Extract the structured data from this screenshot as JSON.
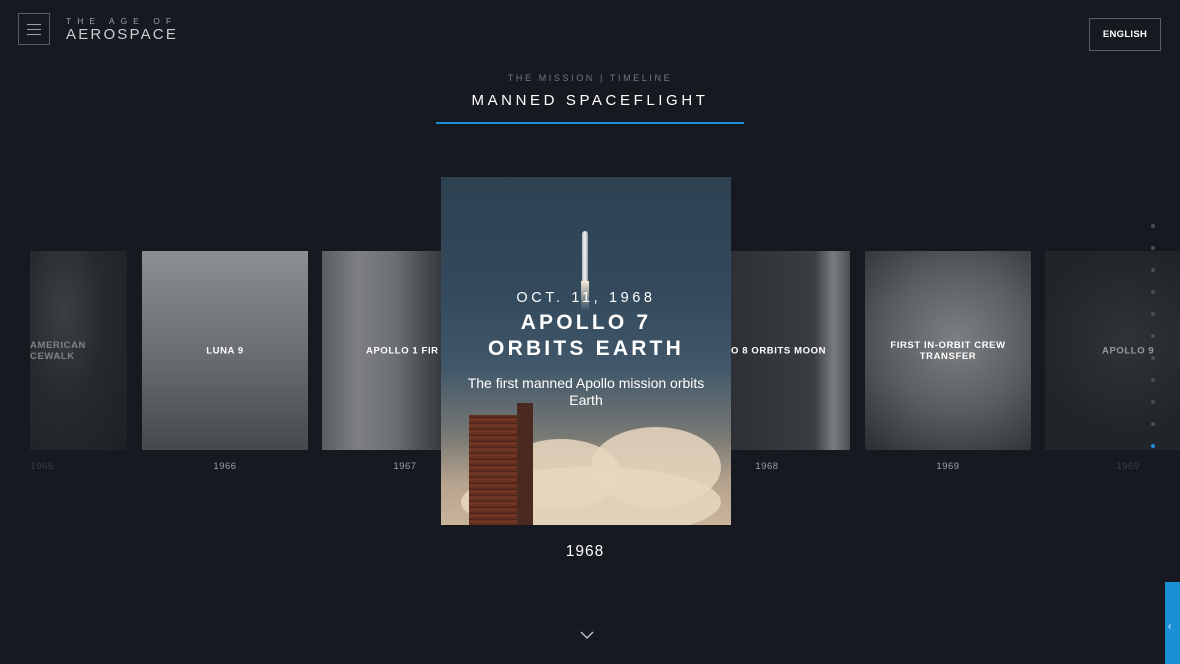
{
  "header": {
    "menu_icon": "hamburger-menu-icon",
    "logo_top": "THE AGE OF",
    "logo_main": "AEROSPACE",
    "language_label": "ENGLISH"
  },
  "section": {
    "subtitle": "THE MISSION | TIMELINE",
    "title": "MANNED SPACEFLIGHT",
    "accent_color": "#1b8fd6"
  },
  "timeline": {
    "cards": [
      {
        "label": "AMERICAN\nCEWALK",
        "year": "1965"
      },
      {
        "label": "LUNA 9",
        "year": "1966"
      },
      {
        "label": "APOLLO 1 FIR",
        "year": "1967"
      },
      {
        "label": "O 8 ORBITS MOON",
        "year": "1968"
      },
      {
        "label": "FIRST IN-ORBIT CREW\nTRANSFER",
        "year": "1969"
      },
      {
        "label": "APOLLO 9",
        "year": "1969"
      }
    ],
    "featured": {
      "date": "OCT. 11, 1968",
      "title_line1": "APOLLO 7",
      "title_line2": "ORBITS EARTH",
      "description": "The first manned Apollo mission orbits Earth",
      "year": "1968"
    },
    "pager": {
      "total": 11,
      "active_index": 10
    }
  },
  "footer": {
    "scroll_icon": "chevron-down-icon",
    "side_tab_icon": "chevron-left-icon",
    "side_tab_glyph": "‹"
  }
}
